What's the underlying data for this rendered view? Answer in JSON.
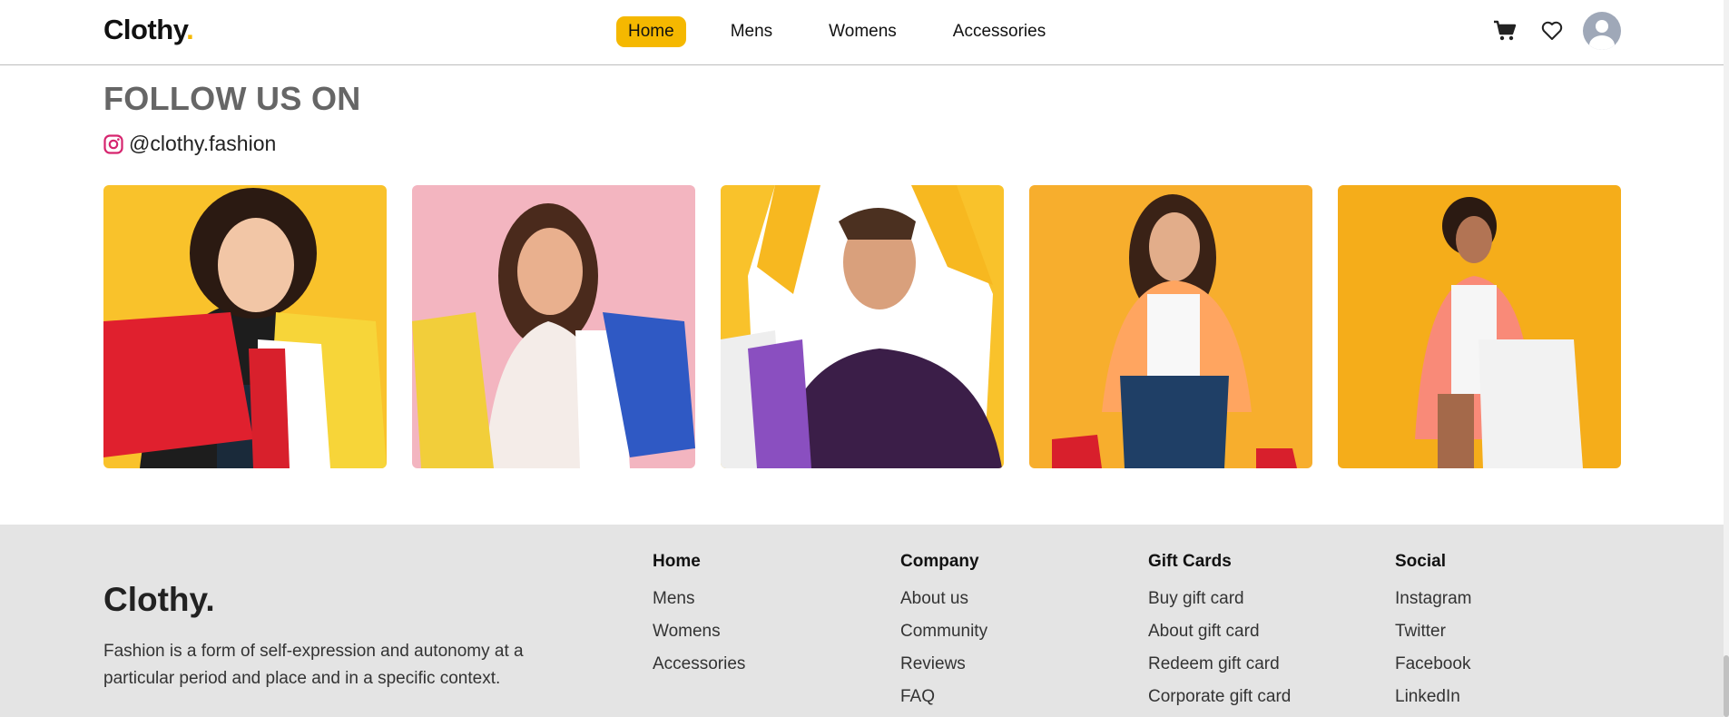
{
  "navbar": {
    "brand": "Clothy",
    "brand_dot": ".",
    "links": [
      {
        "label": "Home",
        "active": true
      },
      {
        "label": "Mens",
        "active": false
      },
      {
        "label": "Womens",
        "active": false
      },
      {
        "label": "Accessories",
        "active": false
      }
    ],
    "icons": [
      "cart-icon",
      "heart-icon",
      "avatar-icon"
    ]
  },
  "follow": {
    "title": "FOLLOW US ON",
    "handle": "@clothy.fashion",
    "handle_icon": "instagram-icon",
    "photos": [
      {
        "name": "photo-woman-red-bags"
      },
      {
        "name": "photo-woman-pink-bags"
      },
      {
        "name": "photo-man-purple-sweater"
      },
      {
        "name": "photo-woman-orange-jacket"
      },
      {
        "name": "photo-woman-coral-blazer"
      }
    ]
  },
  "footer": {
    "brand": "Clothy.",
    "description": "Fashion is a form of self-expression and autonomy at a particular period and place and in a specific context.",
    "columns": [
      {
        "heading": "Home",
        "links": [
          "Mens",
          "Womens",
          "Accessories"
        ]
      },
      {
        "heading": "Company",
        "links": [
          "About us",
          "Community",
          "Reviews",
          "FAQ"
        ]
      },
      {
        "heading": "Gift Cards",
        "links": [
          "Buy gift card",
          "About gift card",
          "Redeem gift card",
          "Corporate gift card"
        ]
      },
      {
        "heading": "Social",
        "links": [
          "Instagram",
          "Twitter",
          "Facebook",
          "LinkedIn"
        ]
      }
    ]
  },
  "colors": {
    "accent": "#f5b800",
    "footer_bg": "#e4e4e4",
    "heading_gray": "#666666"
  }
}
